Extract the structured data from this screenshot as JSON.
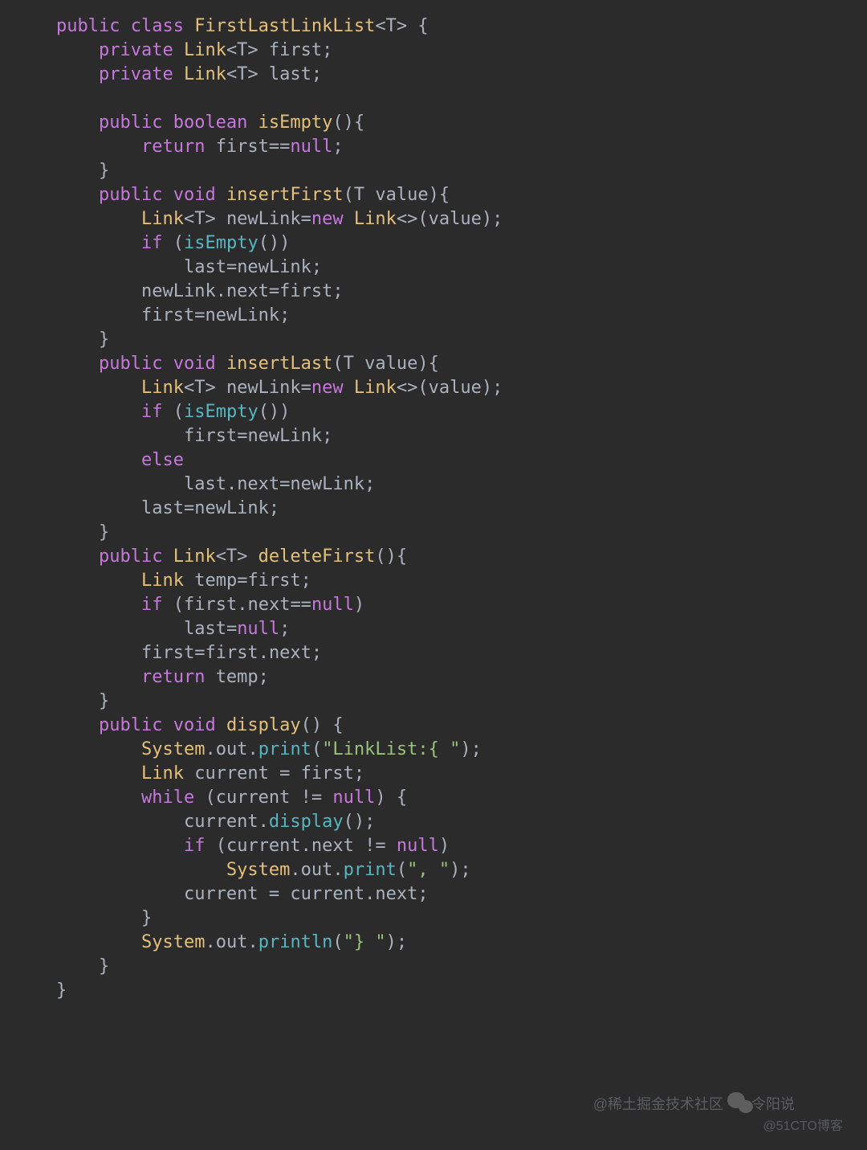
{
  "code": {
    "lines": [
      [
        {
          "t": "public ",
          "c": "kw"
        },
        {
          "t": "class ",
          "c": "kw"
        },
        {
          "t": "FirstLastLinkList",
          "c": "type"
        },
        {
          "t": "<T> {",
          "c": "op"
        }
      ],
      [
        {
          "t": "    ",
          "c": "op"
        },
        {
          "t": "private ",
          "c": "kw"
        },
        {
          "t": "Link",
          "c": "type"
        },
        {
          "t": "<T> ",
          "c": "op"
        },
        {
          "t": "first",
          "c": "id"
        },
        {
          "t": ";",
          "c": "op"
        }
      ],
      [
        {
          "t": "    ",
          "c": "op"
        },
        {
          "t": "private ",
          "c": "kw"
        },
        {
          "t": "Link",
          "c": "type"
        },
        {
          "t": "<T> ",
          "c": "op"
        },
        {
          "t": "last",
          "c": "id"
        },
        {
          "t": ";",
          "c": "op"
        }
      ],
      [
        {
          "t": "",
          "c": "op"
        }
      ],
      [
        {
          "t": "    ",
          "c": "op"
        },
        {
          "t": "public ",
          "c": "kw"
        },
        {
          "t": "boolean ",
          "c": "kw"
        },
        {
          "t": "isEmpty",
          "c": "fn"
        },
        {
          "t": "(){",
          "c": "op"
        }
      ],
      [
        {
          "t": "        ",
          "c": "op"
        },
        {
          "t": "return ",
          "c": "kw"
        },
        {
          "t": "first",
          "c": "id"
        },
        {
          "t": "==",
          "c": "op"
        },
        {
          "t": "null",
          "c": "kw"
        },
        {
          "t": ";",
          "c": "op"
        }
      ],
      [
        {
          "t": "    }",
          "c": "op"
        }
      ],
      [
        {
          "t": "    ",
          "c": "op"
        },
        {
          "t": "public ",
          "c": "kw"
        },
        {
          "t": "void ",
          "c": "kw"
        },
        {
          "t": "insertFirst",
          "c": "fn"
        },
        {
          "t": "(T ",
          "c": "op"
        },
        {
          "t": "value",
          "c": "id"
        },
        {
          "t": "){",
          "c": "op"
        }
      ],
      [
        {
          "t": "        ",
          "c": "op"
        },
        {
          "t": "Link",
          "c": "type"
        },
        {
          "t": "<T> ",
          "c": "op"
        },
        {
          "t": "newLink",
          "c": "id"
        },
        {
          "t": "=",
          "c": "op"
        },
        {
          "t": "new ",
          "c": "kw"
        },
        {
          "t": "Link",
          "c": "type"
        },
        {
          "t": "<>(",
          "c": "op"
        },
        {
          "t": "value",
          "c": "id"
        },
        {
          "t": ");",
          "c": "op"
        }
      ],
      [
        {
          "t": "        ",
          "c": "op"
        },
        {
          "t": "if ",
          "c": "kw"
        },
        {
          "t": "(",
          "c": "op"
        },
        {
          "t": "isEmpty",
          "c": "call"
        },
        {
          "t": "())",
          "c": "op"
        }
      ],
      [
        {
          "t": "            ",
          "c": "op"
        },
        {
          "t": "last",
          "c": "id"
        },
        {
          "t": "=",
          "c": "op"
        },
        {
          "t": "newLink",
          "c": "id"
        },
        {
          "t": ";",
          "c": "op"
        }
      ],
      [
        {
          "t": "        ",
          "c": "op"
        },
        {
          "t": "newLink",
          "c": "id"
        },
        {
          "t": ".",
          "c": "op"
        },
        {
          "t": "next",
          "c": "id"
        },
        {
          "t": "=",
          "c": "op"
        },
        {
          "t": "first",
          "c": "id"
        },
        {
          "t": ";",
          "c": "op"
        }
      ],
      [
        {
          "t": "        ",
          "c": "op"
        },
        {
          "t": "first",
          "c": "id"
        },
        {
          "t": "=",
          "c": "op"
        },
        {
          "t": "newLink",
          "c": "id"
        },
        {
          "t": ";",
          "c": "op"
        }
      ],
      [
        {
          "t": "    }",
          "c": "op"
        }
      ],
      [
        {
          "t": "    ",
          "c": "op"
        },
        {
          "t": "public ",
          "c": "kw"
        },
        {
          "t": "void ",
          "c": "kw"
        },
        {
          "t": "insertLast",
          "c": "fn"
        },
        {
          "t": "(T ",
          "c": "op"
        },
        {
          "t": "value",
          "c": "id"
        },
        {
          "t": "){",
          "c": "op"
        }
      ],
      [
        {
          "t": "        ",
          "c": "op"
        },
        {
          "t": "Link",
          "c": "type"
        },
        {
          "t": "<T> ",
          "c": "op"
        },
        {
          "t": "newLink",
          "c": "id"
        },
        {
          "t": "=",
          "c": "op"
        },
        {
          "t": "new ",
          "c": "kw"
        },
        {
          "t": "Link",
          "c": "type"
        },
        {
          "t": "<>(",
          "c": "op"
        },
        {
          "t": "value",
          "c": "id"
        },
        {
          "t": ");",
          "c": "op"
        }
      ],
      [
        {
          "t": "        ",
          "c": "op"
        },
        {
          "t": "if ",
          "c": "kw"
        },
        {
          "t": "(",
          "c": "op"
        },
        {
          "t": "isEmpty",
          "c": "call"
        },
        {
          "t": "())",
          "c": "op"
        }
      ],
      [
        {
          "t": "            ",
          "c": "op"
        },
        {
          "t": "first",
          "c": "id"
        },
        {
          "t": "=",
          "c": "op"
        },
        {
          "t": "newLink",
          "c": "id"
        },
        {
          "t": ";",
          "c": "op"
        }
      ],
      [
        {
          "t": "        ",
          "c": "op"
        },
        {
          "t": "else",
          "c": "kw"
        }
      ],
      [
        {
          "t": "            ",
          "c": "op"
        },
        {
          "t": "last",
          "c": "id"
        },
        {
          "t": ".",
          "c": "op"
        },
        {
          "t": "next",
          "c": "id"
        },
        {
          "t": "=",
          "c": "op"
        },
        {
          "t": "newLink",
          "c": "id"
        },
        {
          "t": ";",
          "c": "op"
        }
      ],
      [
        {
          "t": "        ",
          "c": "op"
        },
        {
          "t": "last",
          "c": "id"
        },
        {
          "t": "=",
          "c": "op"
        },
        {
          "t": "newLink",
          "c": "id"
        },
        {
          "t": ";",
          "c": "op"
        }
      ],
      [
        {
          "t": "    }",
          "c": "op"
        }
      ],
      [
        {
          "t": "    ",
          "c": "op"
        },
        {
          "t": "public ",
          "c": "kw"
        },
        {
          "t": "Link",
          "c": "type"
        },
        {
          "t": "<T> ",
          "c": "op"
        },
        {
          "t": "deleteFirst",
          "c": "fn"
        },
        {
          "t": "(){",
          "c": "op"
        }
      ],
      [
        {
          "t": "        ",
          "c": "op"
        },
        {
          "t": "Link ",
          "c": "type"
        },
        {
          "t": "temp",
          "c": "id"
        },
        {
          "t": "=",
          "c": "op"
        },
        {
          "t": "first",
          "c": "id"
        },
        {
          "t": ";",
          "c": "op"
        }
      ],
      [
        {
          "t": "        ",
          "c": "op"
        },
        {
          "t": "if ",
          "c": "kw"
        },
        {
          "t": "(",
          "c": "op"
        },
        {
          "t": "first",
          "c": "id"
        },
        {
          "t": ".",
          "c": "op"
        },
        {
          "t": "next",
          "c": "id"
        },
        {
          "t": "==",
          "c": "op"
        },
        {
          "t": "null",
          "c": "kw"
        },
        {
          "t": ")",
          "c": "op"
        }
      ],
      [
        {
          "t": "            ",
          "c": "op"
        },
        {
          "t": "last",
          "c": "id"
        },
        {
          "t": "=",
          "c": "op"
        },
        {
          "t": "null",
          "c": "kw"
        },
        {
          "t": ";",
          "c": "op"
        }
      ],
      [
        {
          "t": "        ",
          "c": "op"
        },
        {
          "t": "first",
          "c": "id"
        },
        {
          "t": "=",
          "c": "op"
        },
        {
          "t": "first",
          "c": "id"
        },
        {
          "t": ".",
          "c": "op"
        },
        {
          "t": "next",
          "c": "id"
        },
        {
          "t": ";",
          "c": "op"
        }
      ],
      [
        {
          "t": "        ",
          "c": "op"
        },
        {
          "t": "return ",
          "c": "kw"
        },
        {
          "t": "temp",
          "c": "id"
        },
        {
          "t": ";",
          "c": "op"
        }
      ],
      [
        {
          "t": "    }",
          "c": "op"
        }
      ],
      [
        {
          "t": "    ",
          "c": "op"
        },
        {
          "t": "public ",
          "c": "kw"
        },
        {
          "t": "void ",
          "c": "kw"
        },
        {
          "t": "display",
          "c": "fn"
        },
        {
          "t": "() {",
          "c": "op"
        }
      ],
      [
        {
          "t": "        ",
          "c": "op"
        },
        {
          "t": "System",
          "c": "type"
        },
        {
          "t": ".",
          "c": "op"
        },
        {
          "t": "out",
          "c": "id"
        },
        {
          "t": ".",
          "c": "op"
        },
        {
          "t": "print",
          "c": "call"
        },
        {
          "t": "(",
          "c": "op"
        },
        {
          "t": "\"LinkList:{ \"",
          "c": "str"
        },
        {
          "t": ");",
          "c": "op"
        }
      ],
      [
        {
          "t": "        ",
          "c": "op"
        },
        {
          "t": "Link ",
          "c": "type"
        },
        {
          "t": "current",
          "c": "id"
        },
        {
          "t": " = ",
          "c": "op"
        },
        {
          "t": "first",
          "c": "id"
        },
        {
          "t": ";",
          "c": "op"
        }
      ],
      [
        {
          "t": "        ",
          "c": "op"
        },
        {
          "t": "while ",
          "c": "kw"
        },
        {
          "t": "(",
          "c": "op"
        },
        {
          "t": "current",
          "c": "id"
        },
        {
          "t": " != ",
          "c": "op"
        },
        {
          "t": "null",
          "c": "kw"
        },
        {
          "t": ") {",
          "c": "op"
        }
      ],
      [
        {
          "t": "            ",
          "c": "op"
        },
        {
          "t": "current",
          "c": "id"
        },
        {
          "t": ".",
          "c": "op"
        },
        {
          "t": "display",
          "c": "call"
        },
        {
          "t": "();",
          "c": "op"
        }
      ],
      [
        {
          "t": "            ",
          "c": "op"
        },
        {
          "t": "if ",
          "c": "kw"
        },
        {
          "t": "(",
          "c": "op"
        },
        {
          "t": "current",
          "c": "id"
        },
        {
          "t": ".",
          "c": "op"
        },
        {
          "t": "next",
          "c": "id"
        },
        {
          "t": " != ",
          "c": "op"
        },
        {
          "t": "null",
          "c": "kw"
        },
        {
          "t": ")",
          "c": "op"
        }
      ],
      [
        {
          "t": "                ",
          "c": "op"
        },
        {
          "t": "System",
          "c": "type"
        },
        {
          "t": ".",
          "c": "op"
        },
        {
          "t": "out",
          "c": "id"
        },
        {
          "t": ".",
          "c": "op"
        },
        {
          "t": "print",
          "c": "call"
        },
        {
          "t": "(",
          "c": "op"
        },
        {
          "t": "\", \"",
          "c": "str"
        },
        {
          "t": ");",
          "c": "op"
        }
      ],
      [
        {
          "t": "            ",
          "c": "op"
        },
        {
          "t": "current",
          "c": "id"
        },
        {
          "t": " = ",
          "c": "op"
        },
        {
          "t": "current",
          "c": "id"
        },
        {
          "t": ".",
          "c": "op"
        },
        {
          "t": "next",
          "c": "id"
        },
        {
          "t": ";",
          "c": "op"
        }
      ],
      [
        {
          "t": "        }",
          "c": "op"
        }
      ],
      [
        {
          "t": "        ",
          "c": "op"
        },
        {
          "t": "System",
          "c": "type"
        },
        {
          "t": ".",
          "c": "op"
        },
        {
          "t": "out",
          "c": "id"
        },
        {
          "t": ".",
          "c": "op"
        },
        {
          "t": "println",
          "c": "call"
        },
        {
          "t": "(",
          "c": "op"
        },
        {
          "t": "\"} \"",
          "c": "str"
        },
        {
          "t": ");",
          "c": "op"
        }
      ],
      [
        {
          "t": "    }",
          "c": "op"
        }
      ],
      [
        {
          "t": "}",
          "c": "op"
        }
      ]
    ]
  },
  "watermarks": {
    "left": "@稀土掘金技术社区",
    "right_top": "令阳说",
    "bottom": "@51CTO博客"
  }
}
